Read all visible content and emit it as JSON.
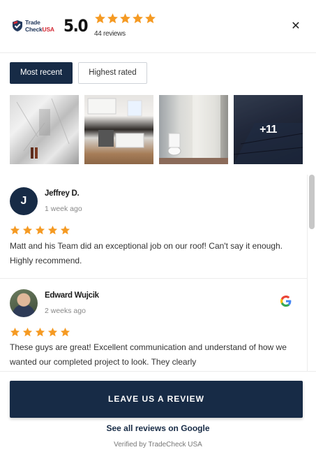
{
  "brand": {
    "line1": "Trade",
    "line2": "Check",
    "line2_accent": "USA",
    "color": "#23395d",
    "accent": "#d42a35"
  },
  "summary": {
    "rating": "5.0",
    "stars": 5,
    "review_count": "44 reviews"
  },
  "close_icon": "close-icon",
  "tabs": [
    {
      "label": "Most recent",
      "active": true
    },
    {
      "label": "Highest rated",
      "active": false
    }
  ],
  "photos": {
    "more_label": "+11"
  },
  "reviews": [
    {
      "name": "Jeffrey D.",
      "initial": "J",
      "date": "1 week ago",
      "stars": 5,
      "text": "Matt and his Team did an exceptional job on our roof! Can't say it enough. Highly recommend.",
      "source_icon": ""
    },
    {
      "name": "Edward Wujcik",
      "initial": "",
      "date": "2 weeks ago",
      "stars": 5,
      "text": "These guys are great! Excellent communication and understand of how we wanted our completed project to look. They clearly",
      "source_icon": "google-icon"
    }
  ],
  "cta_label": "LEAVE US A REVIEW",
  "google_link": "See all reviews on Google",
  "verified": "Verified by TradeCheck USA",
  "colors": {
    "navy": "#172b46",
    "star": "#f59a23"
  }
}
